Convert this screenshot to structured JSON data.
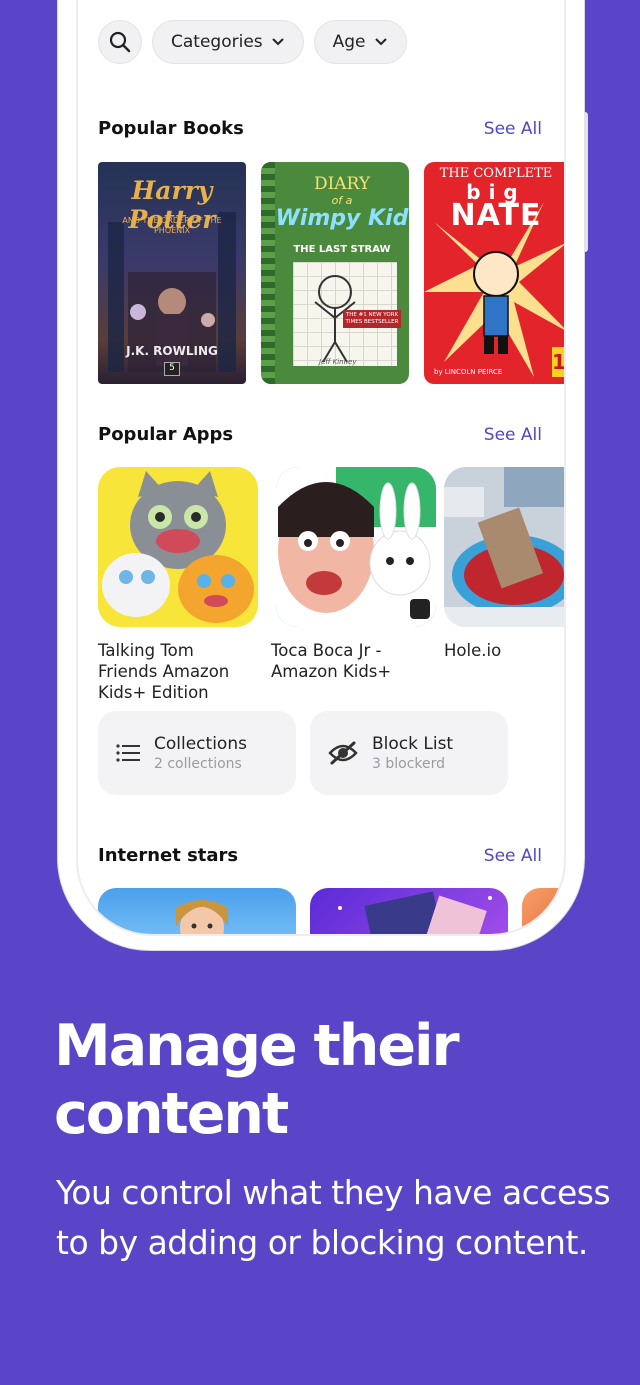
{
  "filters": {
    "categories_label": "Categories",
    "age_label": "Age"
  },
  "popular_books": {
    "title": "Popular Books",
    "see_all": "See All",
    "books": [
      {
        "title_line1": "Harry Potter",
        "subtitle": "AND THE ORDER OF THE PHOENIX",
        "author": "J.K. ROWLING",
        "number": "5"
      },
      {
        "title_line1": "DIARY",
        "title_line2": "of a",
        "title_line3": "Wimpy Kid",
        "subtitle": "THE LAST STRAW",
        "badge": "THE #1 NEW YORK TIMES BESTSELLER",
        "author": "Jeff Kinney"
      },
      {
        "title_line1": "THE COMPLETE",
        "title_line2": "big",
        "title_line3": "NATE",
        "author": "by LINCOLN PEIRCE",
        "number": "1"
      }
    ]
  },
  "popular_apps": {
    "title": "Popular Apps",
    "see_all": "See All",
    "apps": [
      {
        "name": "Talking Tom Friends Amazon Kids+ Edition"
      },
      {
        "name": "Toca Boca Jr - Amazon Kids+"
      },
      {
        "name": "Hole.io"
      }
    ]
  },
  "cards": {
    "collections": {
      "title": "Collections",
      "sub": "2 collections"
    },
    "block_list": {
      "title": "Block List",
      "sub": "3 blockerd"
    }
  },
  "internet_stars": {
    "title": "Internet stars",
    "see_all": "See All"
  },
  "marketing": {
    "headline": "Manage their content",
    "subcopy": "You control what they have access to by adding or blocking content."
  },
  "colors": {
    "background": "#5a44c8",
    "accent": "#4f46c8"
  }
}
